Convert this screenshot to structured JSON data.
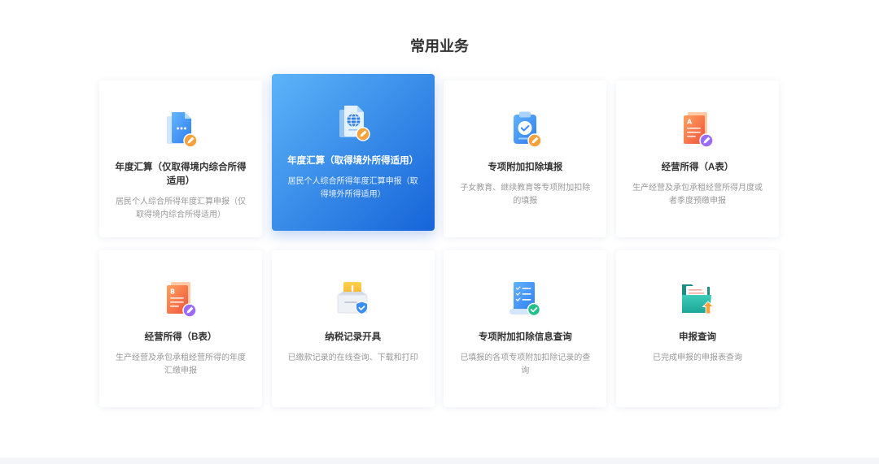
{
  "section_title": "常用业务",
  "colors": {
    "title": "#333333",
    "desc": "#999999",
    "accent_start": "#5db4f8",
    "accent_end": "#1664d9",
    "footer": "#f3f5f9"
  },
  "services": [
    {
      "title": "年度汇算（仅取得境内综合所得适用）",
      "desc": "居民个人综合所得年度汇算申报（仅取得境内综合所得适用）",
      "icon": "document-dots-icon",
      "active": false
    },
    {
      "title": "年度汇算（取得境外所得适用）",
      "desc": "居民个人综合所得年度汇算申报（取得境外所得适用）",
      "icon": "document-globe-icon",
      "active": true
    },
    {
      "title": "专项附加扣除填报",
      "desc": "子女教育、继续教育等专项附加扣除的填报",
      "icon": "clipboard-check-icon",
      "active": false
    },
    {
      "title": "经营所得（A表）",
      "desc": "生产经营及承包承租经营所得月度或者季度预缴申报",
      "icon": "document-letter-icon",
      "icon_letter": "A",
      "active": false
    },
    {
      "title": "经营所得（B表）",
      "desc": "生产经营及承包承租经营所得的年度汇缴申报",
      "icon": "document-letter-icon",
      "icon_letter": "B",
      "active": false
    },
    {
      "title": "纳税记录开具",
      "desc": "已缴款记录的在线查询、下载和打印",
      "icon": "inbox-shield-icon",
      "active": false
    },
    {
      "title": "专项附加扣除信息查询",
      "desc": "已填报的各项专项附加扣除记录的查询",
      "icon": "checklist-scroll-icon",
      "active": false
    },
    {
      "title": "申报查询",
      "desc": "已完成申报的申报表查询",
      "icon": "folder-upload-icon",
      "active": false
    }
  ]
}
